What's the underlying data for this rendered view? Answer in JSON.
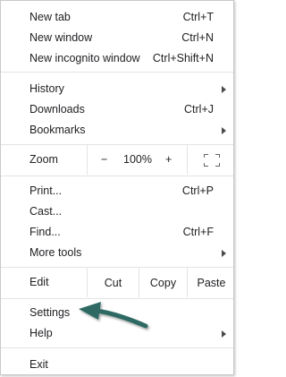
{
  "menu": {
    "group1": [
      {
        "label": "New tab",
        "shortcut": "Ctrl+T"
      },
      {
        "label": "New window",
        "shortcut": "Ctrl+N"
      },
      {
        "label": "New incognito window",
        "shortcut": "Ctrl+Shift+N"
      }
    ],
    "group2": [
      {
        "label": "History",
        "submenu": true
      },
      {
        "label": "Downloads",
        "shortcut": "Ctrl+J"
      },
      {
        "label": "Bookmarks",
        "submenu": true
      }
    ],
    "zoom": {
      "label": "Zoom",
      "minus": "−",
      "level": "100%",
      "plus": "+",
      "fullscreen_icon": "fullscreen-icon"
    },
    "group3": [
      {
        "label": "Print...",
        "shortcut": "Ctrl+P"
      },
      {
        "label": "Cast..."
      },
      {
        "label": "Find...",
        "shortcut": "Ctrl+F"
      },
      {
        "label": "More tools",
        "submenu": true
      }
    ],
    "edit": {
      "label": "Edit",
      "cut": "Cut",
      "copy": "Copy",
      "paste": "Paste"
    },
    "group4": [
      {
        "label": "Settings"
      },
      {
        "label": "Help",
        "submenu": true
      }
    ],
    "group5": [
      {
        "label": "Exit"
      }
    ]
  },
  "annotation": {
    "arrow_color": "#2e6b64",
    "points_to": "Settings"
  }
}
